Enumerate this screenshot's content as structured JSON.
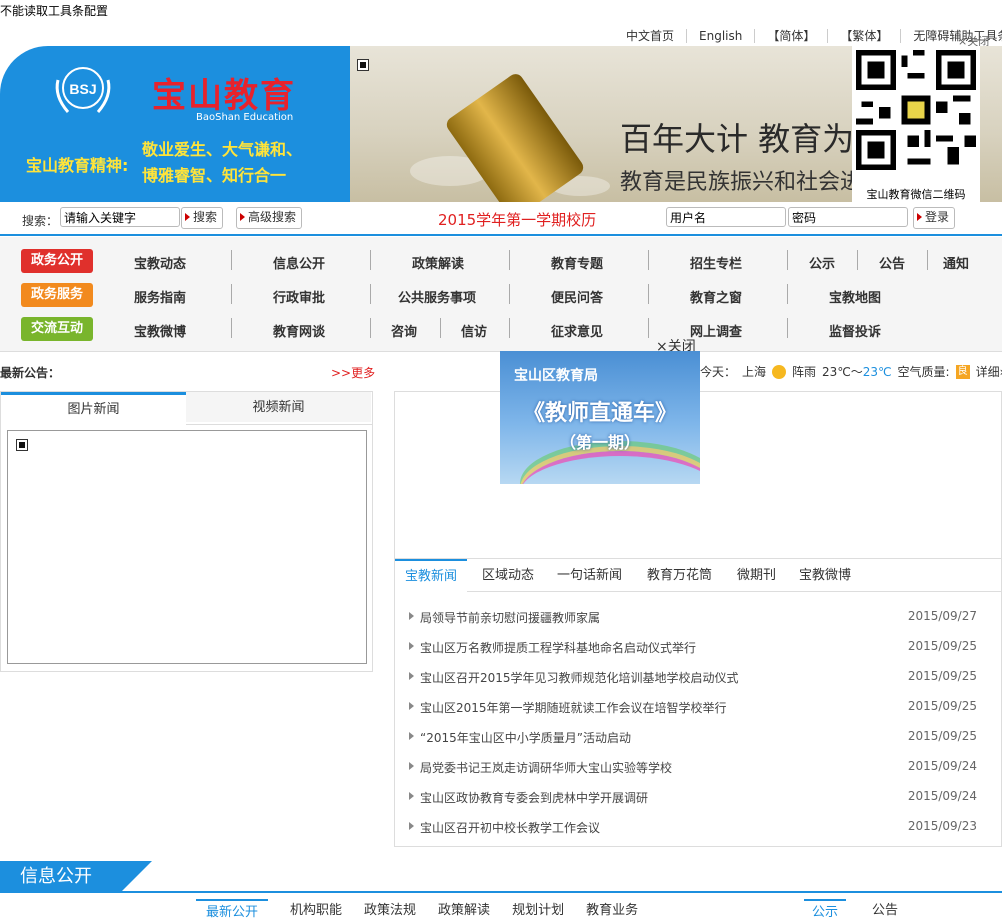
{
  "toolbar_message": "不能读取工具条配置",
  "top_links": [
    "中文首页",
    "English",
    "【简体】",
    "【繁体】",
    "无障碍辅助工具条"
  ],
  "close_top": "关闭",
  "banner": {
    "logo_cn": "宝山教育",
    "logo_en": "BaoShan Education",
    "logo_emblem_text": "BSJ",
    "spirit_label": "宝山教育精神:",
    "spirit_line1": "敬业爱生、大气谦和、",
    "spirit_line2": "博雅睿智、知行合一",
    "slogan1": "百年大计 教育为本",
    "slogan2": "教育是民族振兴和社会进步",
    "qr_caption": "宝山教育微信二维码"
  },
  "search": {
    "label": "搜索：",
    "placeholder": "请输入关键字",
    "search_button": "搜索",
    "advanced_button": "高级搜索",
    "calendar_link": "2015学年第一学期校历",
    "username_placeholder": "用户名",
    "password_placeholder": "密码",
    "login_button": "登录"
  },
  "nav": {
    "categories": [
      {
        "label": "政务公开",
        "color": "#e0302c"
      },
      {
        "label": "政务服务",
        "color": "#f28a1e"
      },
      {
        "label": "交流互动",
        "color": "#79b52c"
      }
    ],
    "row1": [
      "宝教动态",
      "信息公开",
      "政策解读",
      "教育专题",
      "招生专栏",
      "公示",
      "公告",
      "通知"
    ],
    "row2": [
      "服务指南",
      "行政审批",
      "公共服务事项",
      "便民问答",
      "教育之窗",
      "宝教地图"
    ],
    "row3": [
      "宝教微博",
      "教育网谈",
      "咨询",
      "信访",
      "征求意见",
      "网上调查",
      "监督投诉"
    ]
  },
  "popup": {
    "close": "×关闭",
    "title1": "宝山区教育局",
    "title2": "《教师直通车》",
    "title3": "（第一期）"
  },
  "notice": {
    "label": "最新公告：",
    "more": ">>更多"
  },
  "weather": {
    "today": "今天：",
    "city": "上海",
    "condition": "阵雨",
    "temp_low": "23℃～",
    "temp_high": "23℃",
    "aq_label": "空气质量:",
    "aq_value": "良",
    "detail": "详细»"
  },
  "picnews": {
    "tabs": [
      "图片新闻",
      "视频新闻"
    ]
  },
  "news": {
    "tabs": [
      "宝教新闻",
      "区域动态",
      "一句话新闻",
      "教育万花筒",
      "微期刊",
      "宝教微博"
    ],
    "items": [
      {
        "title": "局领导节前亲切慰问援疆教师家属",
        "date": "2015/09/27"
      },
      {
        "title": "宝山区万名教师提质工程学科基地命名启动仪式举行",
        "date": "2015/09/25"
      },
      {
        "title": "宝山区召开2015学年见习教师规范化培训基地学校启动仪式",
        "date": "2015/09/25"
      },
      {
        "title": "宝山区2015年第一学期随班就读工作会议在培智学校举行",
        "date": "2015/09/25"
      },
      {
        "title": "“2015年宝山区中小学质量月”活动启动",
        "date": "2015/09/25"
      },
      {
        "title": "局党委书记王岚走访调研华师大宝山实验等学校",
        "date": "2015/09/24"
      },
      {
        "title": "宝山区政协教育专委会到虎林中学开展调研",
        "date": "2015/09/24"
      },
      {
        "title": "宝山区召开初中校长教学工作会议",
        "date": "2015/09/23"
      }
    ]
  },
  "info_section": {
    "title": "信息公开",
    "tabs": [
      "最新公开",
      "机构职能",
      "政策法规",
      "政策解读",
      "规划计划",
      "教育业务"
    ],
    "side_tabs": [
      "公示",
      "公告"
    ]
  }
}
